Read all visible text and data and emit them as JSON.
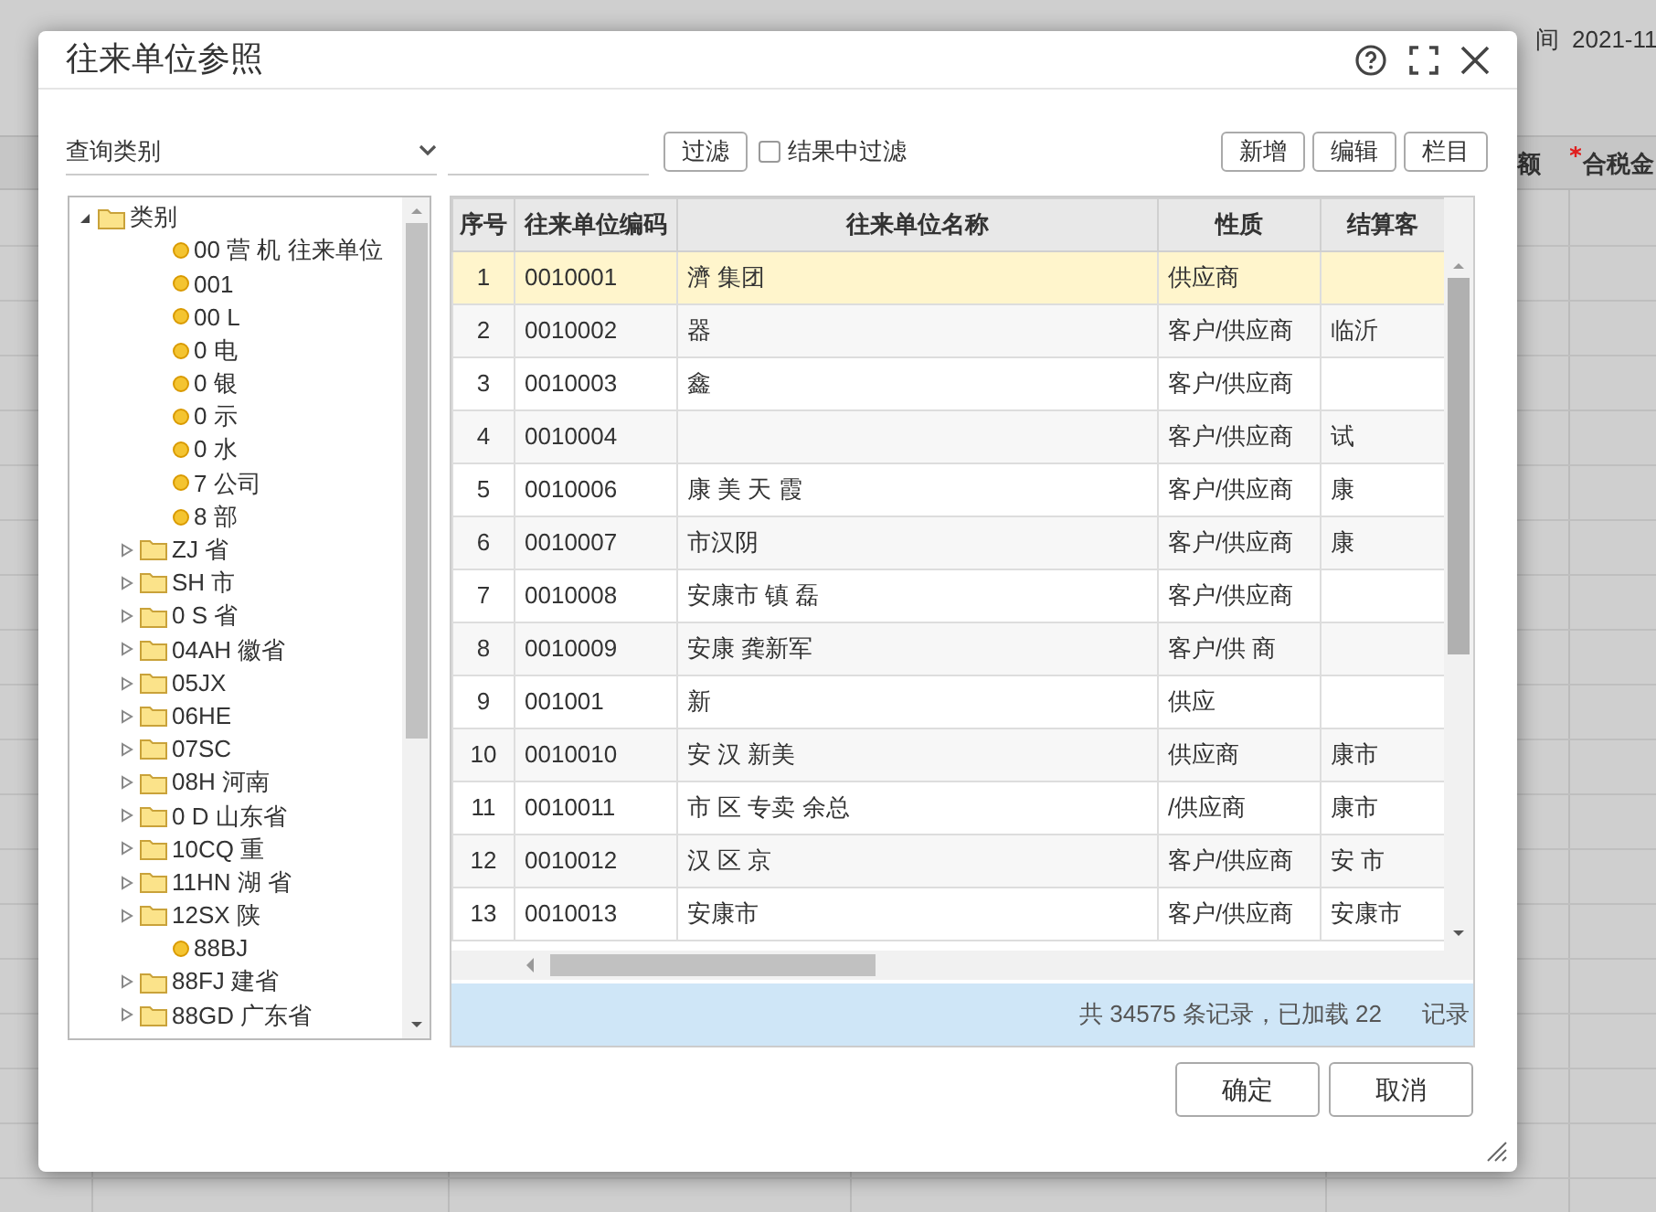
{
  "background": {
    "date_label": "间",
    "date_value": "2021-11",
    "column_a": "额",
    "column_b": "合税金",
    "column_b_required": true
  },
  "window": {
    "title": "往来单位参照"
  },
  "toolbar": {
    "category_select": "查询类别",
    "filter_button": "过滤",
    "filter_in_results": {
      "label": "结果中过滤",
      "checked": false
    },
    "buttons": [
      "新增",
      "编辑",
      "栏目"
    ]
  },
  "tree": {
    "label": "类别",
    "expanded": true,
    "children": [
      {
        "label": "00 营 机 往来单位",
        "kind": "leaf"
      },
      {
        "label": "001",
        "kind": "leaf"
      },
      {
        "label": "00 L",
        "kind": "leaf"
      },
      {
        "label": "0 电",
        "kind": "leaf"
      },
      {
        "label": "0 银",
        "kind": "leaf"
      },
      {
        "label": "0 示",
        "kind": "leaf"
      },
      {
        "label": "0 水",
        "kind": "leaf"
      },
      {
        "label": "7 公司",
        "kind": "leaf"
      },
      {
        "label": "8 部",
        "kind": "leaf"
      },
      {
        "label": "ZJ 省",
        "kind": "folder"
      },
      {
        "label": "SH 市",
        "kind": "folder"
      },
      {
        "label": "0 S 省",
        "kind": "folder"
      },
      {
        "label": "04AH 徽省",
        "kind": "folder"
      },
      {
        "label": "05JX",
        "kind": "folder"
      },
      {
        "label": "06HE",
        "kind": "folder"
      },
      {
        "label": "07SC",
        "kind": "folder"
      },
      {
        "label": "08H 河南",
        "kind": "folder"
      },
      {
        "label": "0 D 山东省",
        "kind": "folder"
      },
      {
        "label": "10CQ 重",
        "kind": "folder"
      },
      {
        "label": "11HN 湖 省",
        "kind": "folder"
      },
      {
        "label": "12SX 陕",
        "kind": "folder"
      },
      {
        "label": "88BJ",
        "kind": "leaf"
      },
      {
        "label": "88FJ 建省",
        "kind": "folder"
      },
      {
        "label": "88GD 广东省",
        "kind": "folder"
      }
    ]
  },
  "table": {
    "columns": [
      "序号",
      "往来单位编码",
      "往来单位名称",
      "性质",
      "结算客"
    ],
    "rows": [
      {
        "cells": [
          "1",
          "0010001",
          "濟 集团",
          "供应商",
          ""
        ],
        "selected": true
      },
      {
        "cells": [
          "2",
          "0010002",
          "器",
          "客户/供应商",
          "临沂"
        ],
        "selected": false
      },
      {
        "cells": [
          "3",
          "0010003",
          "鑫",
          "客户/供应商",
          ""
        ],
        "selected": false
      },
      {
        "cells": [
          "4",
          "0010004",
          "",
          "客户/供应商",
          "试"
        ],
        "selected": false
      },
      {
        "cells": [
          "5",
          "0010006",
          "康 美 天 霞",
          "客户/供应商",
          "康"
        ],
        "selected": false
      },
      {
        "cells": [
          "6",
          "0010007",
          "市汉阴",
          "客户/供应商",
          "康"
        ],
        "selected": false
      },
      {
        "cells": [
          "7",
          "0010008",
          "安康市 镇 磊",
          "客户/供应商",
          ""
        ],
        "selected": false
      },
      {
        "cells": [
          "8",
          "0010009",
          "安康 龚新军",
          "客户/供 商",
          ""
        ],
        "selected": false
      },
      {
        "cells": [
          "9",
          "001001",
          "新",
          "供应",
          ""
        ],
        "selected": false
      },
      {
        "cells": [
          "10",
          "0010010",
          "安 汉 新美",
          "供应商",
          "康市"
        ],
        "selected": false
      },
      {
        "cells": [
          "11",
          "0010011",
          "市 区 专卖 余总",
          "/供应商",
          "康市"
        ],
        "selected": false
      },
      {
        "cells": [
          "12",
          "0010012",
          "汉 区 京",
          "客户/供应商",
          "安 市"
        ],
        "selected": false
      },
      {
        "cells": [
          "13",
          "0010013",
          "安康市",
          "客户/供应商",
          "安康市"
        ],
        "selected": false
      }
    ]
  },
  "footer": "共 34575 条记录，已加载 22",
  "footer_tail": "记录",
  "buttons": [
    "确定",
    "取消"
  ]
}
